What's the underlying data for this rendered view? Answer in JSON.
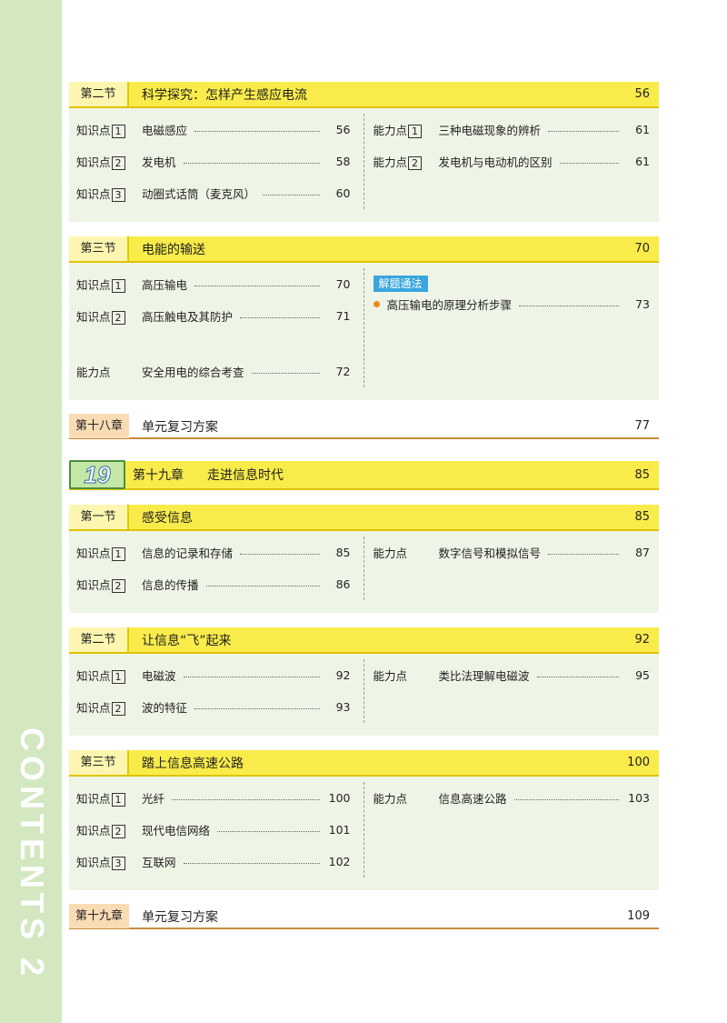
{
  "sidebar": {
    "text": "CONTENTS 2"
  },
  "chapter": {
    "number": "19",
    "label": "第十九章",
    "title": "走进信息时代",
    "page": "85"
  },
  "sec_a": {
    "label": "第二节",
    "title": "科学探究：怎样产生感应电流",
    "page": "56",
    "left": [
      {
        "kp": "知识点",
        "n": "1",
        "text": "电磁感应",
        "page": "56"
      },
      {
        "kp": "知识点",
        "n": "2",
        "text": "发电机",
        "page": "58"
      },
      {
        "kp": "知识点",
        "n": "3",
        "text": "动圈式话筒（麦克风）",
        "page": "60"
      }
    ],
    "right": [
      {
        "kp": "能力点",
        "n": "1",
        "text": "三种电磁现象的辨析",
        "page": "61"
      },
      {
        "kp": "能力点",
        "n": "2",
        "text": "发电机与电动机的区别",
        "page": "61"
      }
    ]
  },
  "sec_b": {
    "label": "第三节",
    "title": "电能的输送",
    "page": "70",
    "left": [
      {
        "kp": "知识点",
        "n": "1",
        "text": "高压输电",
        "page": "70"
      },
      {
        "kp": "知识点",
        "n": "2",
        "text": "高压触电及其防护",
        "page": "71"
      },
      {
        "kp": "能力点",
        "n": "",
        "text": "安全用电的综合考查",
        "page": "72"
      }
    ],
    "tag": "解题通法",
    "bullet": {
      "text": "高压输电的原理分析步骤",
      "page": "73"
    }
  },
  "rev18": {
    "label": "第十八章",
    "title": "单元复习方案",
    "page": "77"
  },
  "sec_c": {
    "label": "第一节",
    "title": "感受信息",
    "page": "85",
    "left": [
      {
        "kp": "知识点",
        "n": "1",
        "text": "信息的记录和存储",
        "page": "85"
      },
      {
        "kp": "知识点",
        "n": "2",
        "text": "信息的传播",
        "page": "86"
      }
    ],
    "right": [
      {
        "kp": "能力点",
        "n": "",
        "text": "数字信号和模拟信号",
        "page": "87"
      }
    ]
  },
  "sec_d": {
    "label": "第二节",
    "title": "让信息“飞”起来",
    "page": "92",
    "left": [
      {
        "kp": "知识点",
        "n": "1",
        "text": "电磁波",
        "page": "92"
      },
      {
        "kp": "知识点",
        "n": "2",
        "text": "波的特征",
        "page": "93"
      }
    ],
    "right": [
      {
        "kp": "能力点",
        "n": "",
        "text": "类比法理解电磁波",
        "page": "95"
      }
    ]
  },
  "sec_e": {
    "label": "第三节",
    "title": "踏上信息高速公路",
    "page": "100",
    "left": [
      {
        "kp": "知识点",
        "n": "1",
        "text": "光纤",
        "page": "100"
      },
      {
        "kp": "知识点",
        "n": "2",
        "text": "现代电信网络",
        "page": "101"
      },
      {
        "kp": "知识点",
        "n": "3",
        "text": "互联网",
        "page": "102"
      }
    ],
    "right": [
      {
        "kp": "能力点",
        "n": "",
        "text": "信息高速公路",
        "page": "103"
      }
    ]
  },
  "rev19": {
    "label": "第十九章",
    "title": "单元复习方案",
    "page": "109"
  }
}
